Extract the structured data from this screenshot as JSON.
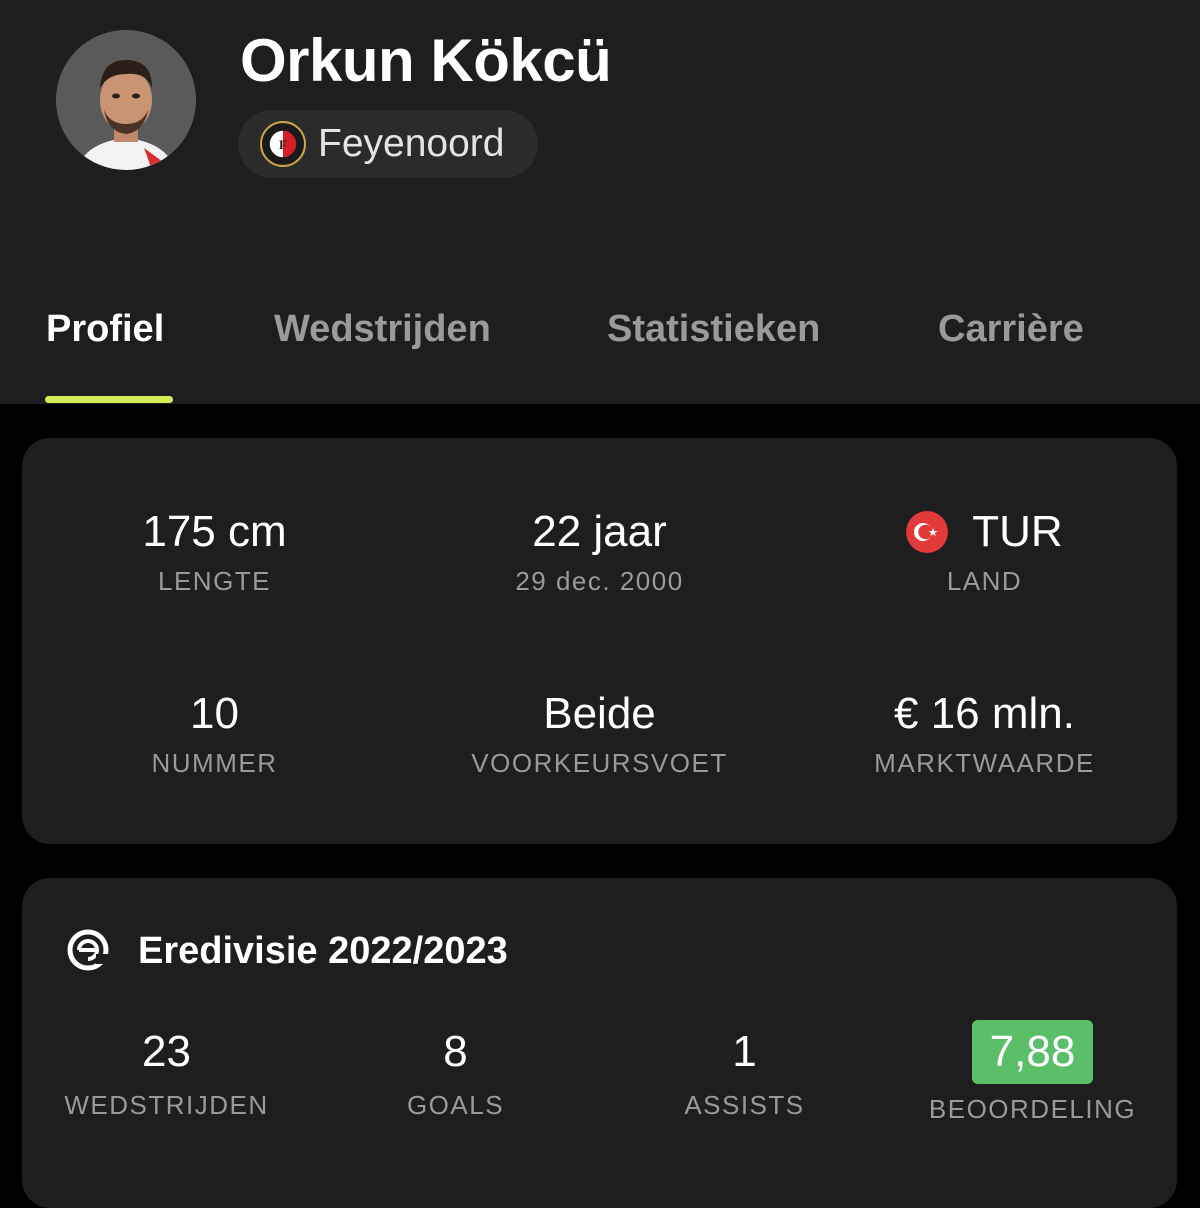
{
  "player": {
    "name": "Orkun Kökcü",
    "club": "Feyenoord",
    "club_logo_icon": "feyenoord-crest-icon",
    "avatar_icon": "player-avatar"
  },
  "tabs": [
    {
      "label": "Profiel",
      "active": true
    },
    {
      "label": "Wedstrijden",
      "active": false
    },
    {
      "label": "Statistieken",
      "active": false
    },
    {
      "label": "Carrière",
      "active": false
    }
  ],
  "colors": {
    "accent": "#d4ec58",
    "rating_bg": "#5bbf6a",
    "card_bg": "#1e1e1e",
    "page_bg": "#000000"
  },
  "profile": {
    "height": {
      "value": "175 cm",
      "label": "LENGTE"
    },
    "age": {
      "value": "22 jaar",
      "label": "29 dec. 2000"
    },
    "country": {
      "value": "TUR",
      "label": "LAND",
      "flag_icon": "turkey-flag-icon"
    },
    "number": {
      "value": "10",
      "label": "NUMMER"
    },
    "foot": {
      "value": "Beide",
      "label": "VOORKEURSVOET"
    },
    "market_value": {
      "value": "€ 16 mln.",
      "label": "MARKTWAARDE"
    }
  },
  "league": {
    "title": "Eredivisie 2022/2023",
    "icon": "eredivisie-logo-icon",
    "stats": [
      {
        "value": "23",
        "label": "WEDSTRIJDEN"
      },
      {
        "value": "8",
        "label": "GOALS"
      },
      {
        "value": "1",
        "label": "ASSISTS"
      },
      {
        "value": "7,88",
        "label": "BEOORDELING"
      }
    ]
  }
}
